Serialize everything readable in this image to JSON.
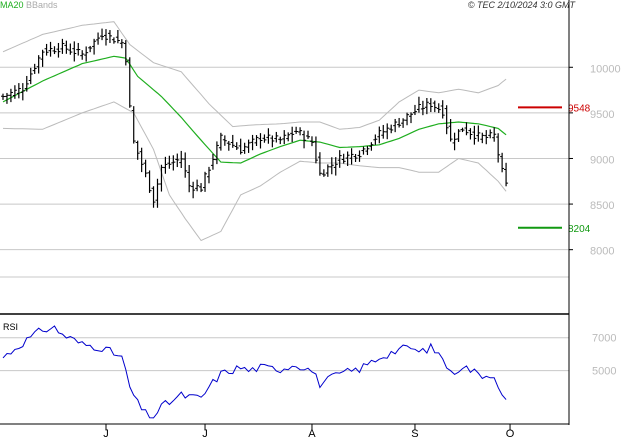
{
  "header": {
    "legend_ma": "MA20",
    "legend_bb": "BBands",
    "copyright": "© TEC 2/10/2024 3:0 GMT"
  },
  "colors": {
    "ma": "#1fae1f",
    "bbands": "#bbbbbb",
    "price": "#000000",
    "rsi": "#0000cc",
    "resistance": "#cc0000",
    "support": "#119911",
    "grid": "#c8c8c8",
    "axis": "#000000",
    "rsi_ticklabel": "#bbbbbb",
    "legend_bb": "#aaaaaa"
  },
  "chart_data": [
    {
      "type": "line",
      "subtype": "ohlc",
      "y_ticks": [
        10000,
        9500,
        9000,
        8500,
        8000
      ],
      "y_ticklabels": [
        "10000",
        "9500",
        "9000",
        "8500",
        "8000"
      ],
      "x_ticklabels": [
        "J",
        "J",
        "A",
        "S",
        "O"
      ],
      "ylim": [
        7470,
        10650
      ],
      "x_count": 130,
      "x_tick_index": [
        26,
        51,
        78,
        104,
        128
      ],
      "levels": [
        {
          "label": "9548",
          "value": 9560,
          "kind": "resistance"
        },
        {
          "label": "8204",
          "value": 8240,
          "kind": "support"
        }
      ],
      "ohlc": "generated",
      "anchors_close": [
        [
          0,
          9680
        ],
        [
          5,
          9770
        ],
        [
          10,
          10180
        ],
        [
          15,
          10220
        ],
        [
          20,
          10140
        ],
        [
          25,
          10370
        ],
        [
          30,
          10270
        ],
        [
          31,
          10100
        ],
        [
          32,
          9550
        ],
        [
          33,
          9180
        ],
        [
          36,
          8820
        ],
        [
          38,
          8550
        ],
        [
          40,
          8900
        ],
        [
          45,
          9000
        ],
        [
          47,
          8700
        ],
        [
          50,
          8680
        ],
        [
          52,
          8900
        ],
        [
          55,
          9220
        ],
        [
          60,
          9100
        ],
        [
          62,
          9150
        ],
        [
          65,
          9230
        ],
        [
          70,
          9200
        ],
        [
          74,
          9300
        ],
        [
          78,
          9180
        ],
        [
          80,
          8830
        ],
        [
          85,
          9000
        ],
        [
          90,
          9060
        ],
        [
          95,
          9270
        ],
        [
          100,
          9400
        ],
        [
          105,
          9550
        ],
        [
          108,
          9600
        ],
        [
          111,
          9520
        ],
        [
          113,
          9200
        ],
        [
          116,
          9330
        ],
        [
          120,
          9240
        ],
        [
          122,
          9230
        ],
        [
          124,
          9250
        ],
        [
          126,
          8850
        ],
        [
          127,
          8700
        ]
      ],
      "ma20": [
        [
          0,
          9620
        ],
        [
          10,
          9850
        ],
        [
          20,
          10040
        ],
        [
          28,
          10120
        ],
        [
          31,
          10100
        ],
        [
          34,
          9900
        ],
        [
          40,
          9680
        ],
        [
          45,
          9450
        ],
        [
          50,
          9200
        ],
        [
          55,
          8960
        ],
        [
          60,
          8950
        ],
        [
          65,
          9050
        ],
        [
          70,
          9130
        ],
        [
          75,
          9200
        ],
        [
          80,
          9180
        ],
        [
          85,
          9120
        ],
        [
          90,
          9130
        ],
        [
          95,
          9150
        ],
        [
          100,
          9220
        ],
        [
          105,
          9320
        ],
        [
          110,
          9380
        ],
        [
          115,
          9400
        ],
        [
          120,
          9380
        ],
        [
          125,
          9330
        ],
        [
          127,
          9260
        ]
      ],
      "bb_upper": [
        [
          0,
          10170
        ],
        [
          10,
          10360
        ],
        [
          20,
          10460
        ],
        [
          28,
          10500
        ],
        [
          32,
          10250
        ],
        [
          38,
          10050
        ],
        [
          45,
          9950
        ],
        [
          52,
          9600
        ],
        [
          58,
          9350
        ],
        [
          64,
          9370
        ],
        [
          70,
          9380
        ],
        [
          75,
          9400
        ],
        [
          80,
          9400
        ],
        [
          85,
          9320
        ],
        [
          90,
          9340
        ],
        [
          95,
          9420
        ],
        [
          100,
          9620
        ],
        [
          105,
          9750
        ],
        [
          110,
          9720
        ],
        [
          115,
          9760
        ],
        [
          120,
          9720
        ],
        [
          125,
          9800
        ],
        [
          127,
          9870
        ]
      ],
      "bb_lower": [
        [
          0,
          9330
        ],
        [
          10,
          9320
        ],
        [
          20,
          9500
        ],
        [
          28,
          9620
        ],
        [
          33,
          9500
        ],
        [
          38,
          9100
        ],
        [
          42,
          8600
        ],
        [
          46,
          8340
        ],
        [
          50,
          8100
        ],
        [
          55,
          8200
        ],
        [
          60,
          8600
        ],
        [
          65,
          8700
        ],
        [
          70,
          8850
        ],
        [
          75,
          8970
        ],
        [
          80,
          8950
        ],
        [
          85,
          8950
        ],
        [
          90,
          8920
        ],
        [
          95,
          8900
        ],
        [
          100,
          8900
        ],
        [
          105,
          8850
        ],
        [
          110,
          8850
        ],
        [
          115,
          9000
        ],
        [
          120,
          8950
        ],
        [
          125,
          8750
        ],
        [
          127,
          8640
        ]
      ]
    },
    {
      "type": "line",
      "title": "RSI",
      "series": [
        {
          "name": "RSI",
          "values": "generated"
        }
      ],
      "y_ticks": [
        70,
        50
      ],
      "y_ticklabels": [
        "7000",
        "5000"
      ],
      "ylim": [
        20,
        82
      ],
      "x_count": 130,
      "anchors": [
        [
          0,
          58
        ],
        [
          5,
          67
        ],
        [
          10,
          75
        ],
        [
          13,
          76
        ],
        [
          15,
          72
        ],
        [
          20,
          66
        ],
        [
          25,
          64
        ],
        [
          30,
          58
        ],
        [
          32,
          40
        ],
        [
          34,
          30
        ],
        [
          36,
          24
        ],
        [
          38,
          22
        ],
        [
          40,
          28
        ],
        [
          45,
          35
        ],
        [
          50,
          33
        ],
        [
          52,
          40
        ],
        [
          55,
          48
        ],
        [
          60,
          52
        ],
        [
          62,
          50
        ],
        [
          65,
          52
        ],
        [
          70,
          51
        ],
        [
          74,
          54
        ],
        [
          78,
          50
        ],
        [
          80,
          42
        ],
        [
          85,
          48
        ],
        [
          90,
          51
        ],
        [
          95,
          58
        ],
        [
          100,
          63
        ],
        [
          103,
          64
        ],
        [
          105,
          61
        ],
        [
          108,
          64
        ],
        [
          111,
          58
        ],
        [
          113,
          48
        ],
        [
          116,
          53
        ],
        [
          120,
          48
        ],
        [
          122,
          47
        ],
        [
          124,
          48
        ],
        [
          126,
          34
        ],
        [
          127,
          32
        ]
      ]
    }
  ]
}
